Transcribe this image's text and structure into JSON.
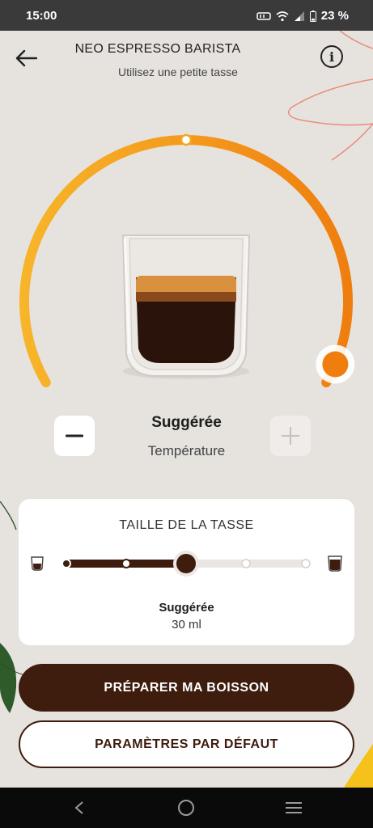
{
  "status_bar": {
    "time": "15:00",
    "battery": "23 %"
  },
  "header": {
    "title": "NEO ESPRESSO BARISTA",
    "subtitle": "Utilisez une petite tasse",
    "info_label": "i"
  },
  "temperature": {
    "value": "Suggérée",
    "label": "Température",
    "level_fraction": 0.97
  },
  "cup_size": {
    "title": "TAILLE DE LA TASSE",
    "value": "Suggérée",
    "volume": "30 ml",
    "steps": 5,
    "selected_step": 3
  },
  "actions": {
    "prepare": "PRÉPARER MA BOISSON",
    "defaults": "PARAMÈTRES PAR DÉFAUT"
  },
  "colors": {
    "accent_orange": "#f08a12",
    "accent_yellow": "#f6b12a",
    "coffee_brown": "#3e1c0e",
    "background": "#e6e3df"
  },
  "icons": {
    "back": "arrow-left-icon",
    "info": "info-icon",
    "minus": "minus-icon",
    "plus": "plus-icon",
    "nav_back": "nav-back-icon",
    "nav_home": "nav-home-icon",
    "nav_menu": "nav-menu-icon"
  }
}
